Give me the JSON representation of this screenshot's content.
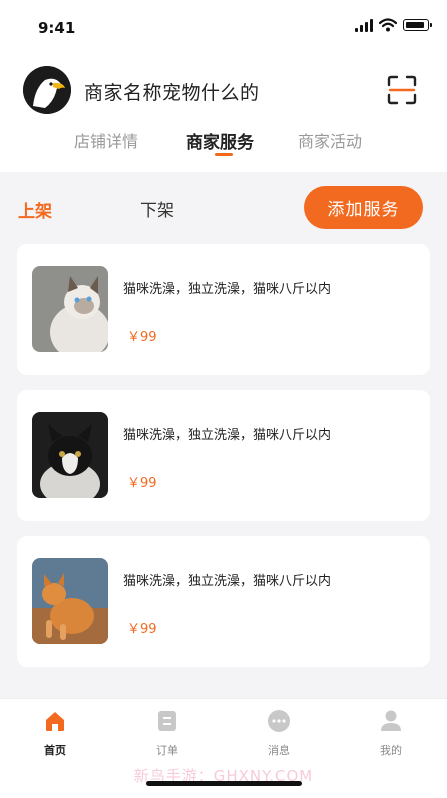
{
  "status": {
    "time": "9:41"
  },
  "header": {
    "shop_name": "商家名称宠物什么的",
    "scan_icon": "scan-icon",
    "avatar_icon": "eagle-avatar"
  },
  "tabs": [
    {
      "label": "店铺详情",
      "active": false
    },
    {
      "label": "商家服务",
      "active": true
    },
    {
      "label": "商家活动",
      "active": false
    }
  ],
  "filter": {
    "on_shelf": "上架",
    "off_shelf": "下架",
    "add_button": "添加服务"
  },
  "services": [
    {
      "title": "猫咪洗澡，独立洗澡，猫咪八斤以内",
      "price": "￥99",
      "image": "white-cat-photo"
    },
    {
      "title": "猫咪洗澡，独立洗澡，猫咪八斤以内",
      "price": "￥99",
      "image": "black-white-cat-photo"
    },
    {
      "title": "猫咪洗澡，独立洗澡，猫咪八斤以内",
      "price": "￥99",
      "image": "orange-cat-photo"
    }
  ],
  "tabbar": [
    {
      "label": "首页",
      "icon": "home-icon",
      "active": true
    },
    {
      "label": "订单",
      "icon": "order-icon",
      "active": false
    },
    {
      "label": "消息",
      "icon": "message-icon",
      "active": false
    },
    {
      "label": "我的",
      "icon": "profile-icon",
      "active": false
    }
  ],
  "watermark": "新鸟手游：GHXNY.COM",
  "colors": {
    "accent": "#f26a1f",
    "price": "#f26a1f",
    "background": "#f4f4f6"
  }
}
